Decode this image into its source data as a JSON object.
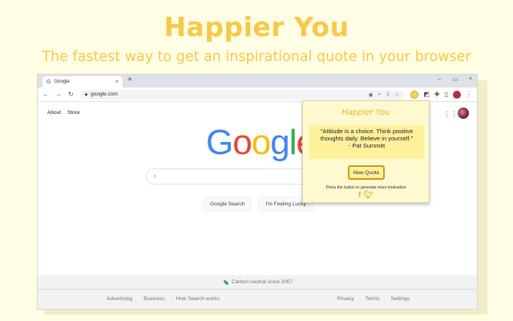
{
  "promo": {
    "title": "Happier You",
    "subtitle": "The fastest way to get an inspirational quote in your browser"
  },
  "browser": {
    "tab_title": "Google",
    "tab_close": "×",
    "new_tab": "+",
    "url": "google.com",
    "window_controls": [
      "–",
      "▭",
      "×"
    ]
  },
  "google": {
    "top_links": [
      "About",
      "Store"
    ],
    "logo_letters": [
      {
        "ch": "G",
        "color": "#4285f4"
      },
      {
        "ch": "o",
        "color": "#ea4335"
      },
      {
        "ch": "o",
        "color": "#fbbc05"
      },
      {
        "ch": "g",
        "color": "#4285f4"
      },
      {
        "ch": "l",
        "color": "#34a853"
      },
      {
        "ch": "e",
        "color": "#ea4335"
      }
    ],
    "search_button": "Google Search",
    "lucky_button": "I'm Feeling Lucky",
    "carbon_text": "Carbon neutral since 2007",
    "footer_left": [
      "Advertising",
      "Business",
      "How Search works"
    ],
    "footer_right": [
      "Privacy",
      "Terms",
      "Settings"
    ]
  },
  "popup": {
    "title": "Happier You",
    "quote": "\"Attitude is a choice. Think positive thoughts daily. Believe in yourself.\"",
    "author": "- Pat Summitt",
    "button": "New Quote",
    "hint": "Press the button to generate more motivation",
    "accent": "#e6b422"
  }
}
